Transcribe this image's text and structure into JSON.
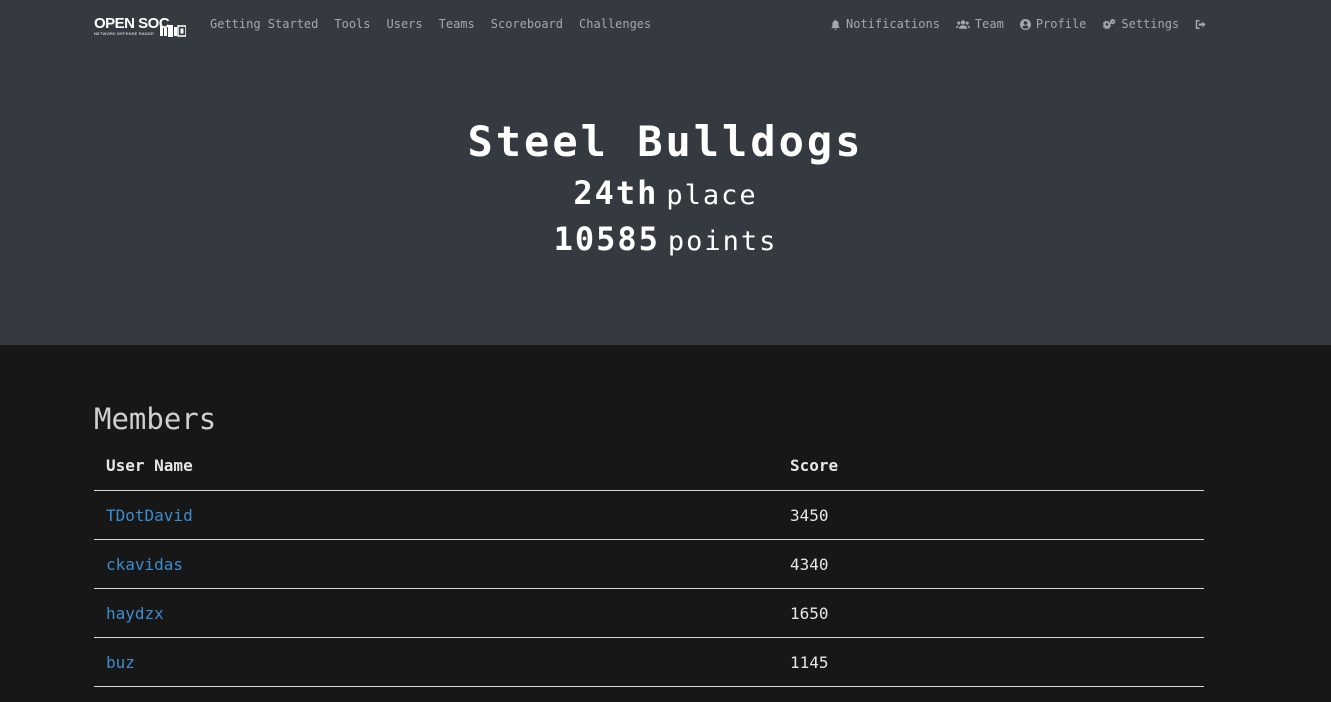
{
  "brand": {
    "name": "OPEN SOC",
    "subtitle": "NETWORK DEFENSE RANGE"
  },
  "nav": {
    "left": [
      {
        "label": "Getting Started"
      },
      {
        "label": "Tools"
      },
      {
        "label": "Users"
      },
      {
        "label": "Teams"
      },
      {
        "label": "Scoreboard"
      },
      {
        "label": "Challenges"
      }
    ],
    "right": {
      "notifications": {
        "label": "Notifications",
        "icon": "bell-icon"
      },
      "team": {
        "label": "Team",
        "icon": "users-icon"
      },
      "profile": {
        "label": "Profile",
        "icon": "user-circle-icon"
      },
      "settings": {
        "label": "Settings",
        "icon": "cogs-icon"
      },
      "logout": {
        "icon": "sign-out-icon"
      }
    }
  },
  "team": {
    "name": "Steel Bulldogs",
    "place": "24th",
    "place_label": "place",
    "points": "10585",
    "points_label": "points"
  },
  "members": {
    "heading": "Members",
    "columns": [
      "User Name",
      "Score"
    ],
    "rows": [
      {
        "name": "TDotDavid",
        "score": "3450"
      },
      {
        "name": "ckavidas",
        "score": "4340"
      },
      {
        "name": "haydzx",
        "score": "1650"
      },
      {
        "name": "buz",
        "score": "1145"
      }
    ]
  },
  "colors": {
    "hero_bg": "#343a40",
    "page_bg": "#171718",
    "link": "#3d8ccd"
  }
}
